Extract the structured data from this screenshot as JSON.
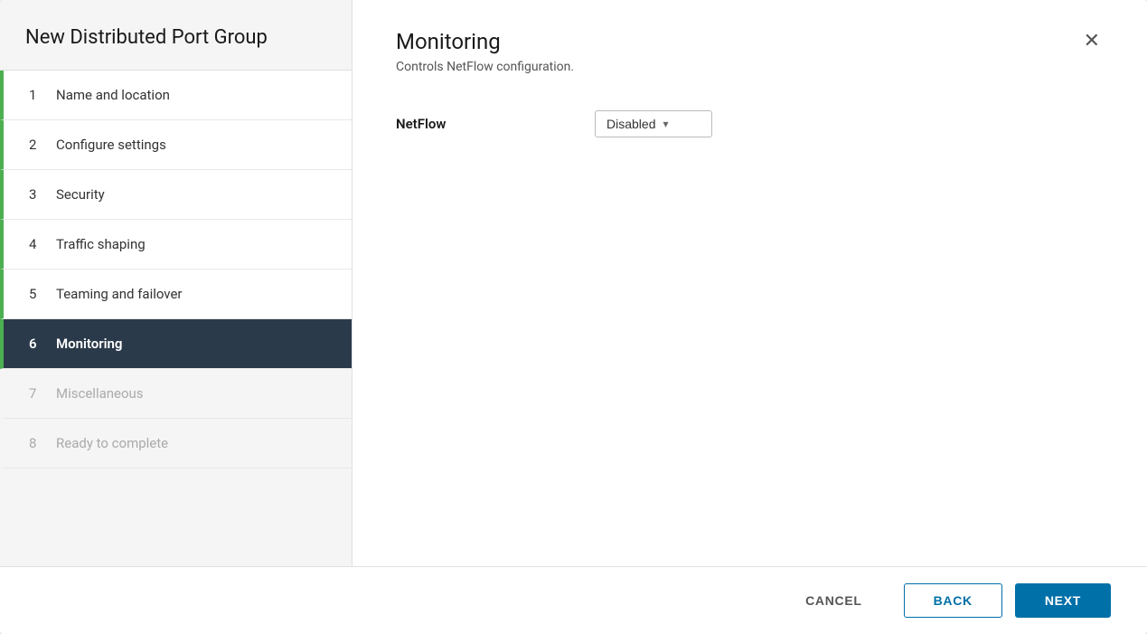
{
  "sidebar": {
    "title": "New Distributed Port Group",
    "items": [
      {
        "id": 1,
        "label": "Name and location",
        "state": "completed"
      },
      {
        "id": 2,
        "label": "Configure settings",
        "state": "completed"
      },
      {
        "id": 3,
        "label": "Security",
        "state": "completed"
      },
      {
        "id": 4,
        "label": "Traffic shaping",
        "state": "completed"
      },
      {
        "id": 5,
        "label": "Teaming and failover",
        "state": "completed"
      },
      {
        "id": 6,
        "label": "Monitoring",
        "state": "active"
      },
      {
        "id": 7,
        "label": "Miscellaneous",
        "state": "disabled"
      },
      {
        "id": 8,
        "label": "Ready to complete",
        "state": "disabled"
      }
    ]
  },
  "main": {
    "title": "Monitoring",
    "subtitle": "Controls NetFlow configuration.",
    "field_label": "NetFlow",
    "dropdown_value": "Disabled",
    "dropdown_chevron": "▾"
  },
  "footer": {
    "cancel_label": "CANCEL",
    "back_label": "BACK",
    "next_label": "NEXT"
  },
  "close_icon": "✕"
}
